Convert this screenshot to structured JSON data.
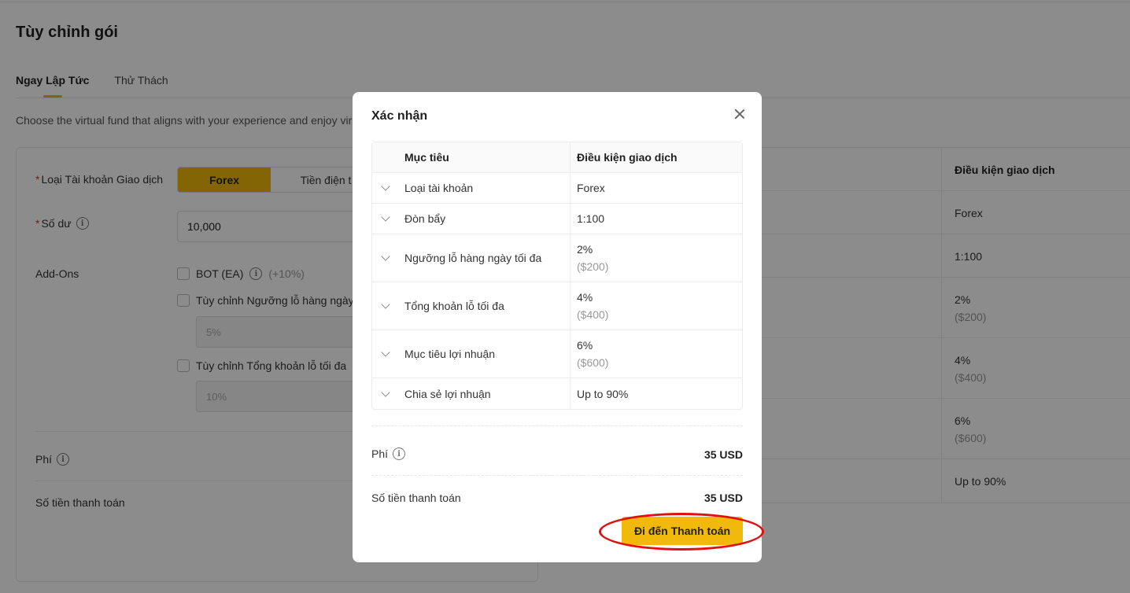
{
  "page": {
    "title": "Tùy chỉnh gói",
    "tabs": [
      {
        "label": "Ngay Lập Tức",
        "active": true
      },
      {
        "label": "Thử Thách",
        "active": false
      }
    ],
    "intro": "Choose the virtual fund that aligns with your experience and enjoy vir"
  },
  "form": {
    "account_type_label": "Loại Tài khoản Giao dịch",
    "account_type_options": [
      "Forex",
      "Tiền điện t"
    ],
    "balance_label": "Số dư",
    "balance_value": "10,000",
    "addons_label": "Add-Ons",
    "addon_bot_label": "BOT (EA)",
    "addon_bot_extra": "(+10%)",
    "addon_daily_loss_label": "Tùy chỉnh Ngưỡng lỗ hàng ngày",
    "addon_daily_loss_placeholder": "5%",
    "addon_total_loss_label": "Tùy chỉnh Tổng khoản lỗ tối đa",
    "addon_total_loss_placeholder": "10%",
    "fee_label": "Phí",
    "payment_label": "Số tiền thanh toán"
  },
  "right_table": {
    "header": "Điều kiện giao dịch",
    "rows": [
      {
        "value": "Forex",
        "sub": ""
      },
      {
        "value": "1:100",
        "sub": ""
      },
      {
        "value": "2%",
        "sub": "($200)"
      },
      {
        "value": "4%",
        "sub": "($400)"
      },
      {
        "value": "6%",
        "sub": "($600)"
      },
      {
        "value": "Up to 90%",
        "sub": ""
      }
    ]
  },
  "modal": {
    "title": "Xác nhận",
    "table": {
      "headers": [
        "Mục tiêu",
        "Điều kiện giao dịch"
      ],
      "rows": [
        {
          "target": "Loại tài khoản",
          "condition": "Forex",
          "sub": ""
        },
        {
          "target": "Đòn bẩy",
          "condition": "1:100",
          "sub": ""
        },
        {
          "target": "Ngưỡng lỗ hàng ngày tối đa",
          "condition": "2%",
          "sub": "($200)"
        },
        {
          "target": "Tổng khoản lỗ tối đa",
          "condition": "4%",
          "sub": "($400)"
        },
        {
          "target": "Mục tiêu lợi nhuận",
          "condition": "6%",
          "sub": "($600)"
        },
        {
          "target": "Chia sẻ lợi nhuận",
          "condition": "Up to 90%",
          "sub": ""
        }
      ]
    },
    "fee_label": "Phí",
    "fee_value": "35 USD",
    "payment_label": "Số tiền thanh toán",
    "payment_value": "35 USD",
    "pay_button": "Đi đến Thanh toán"
  },
  "colors": {
    "accent": "#f0b90b",
    "highlight_ring": "#e01010",
    "required": "#e0333c"
  }
}
